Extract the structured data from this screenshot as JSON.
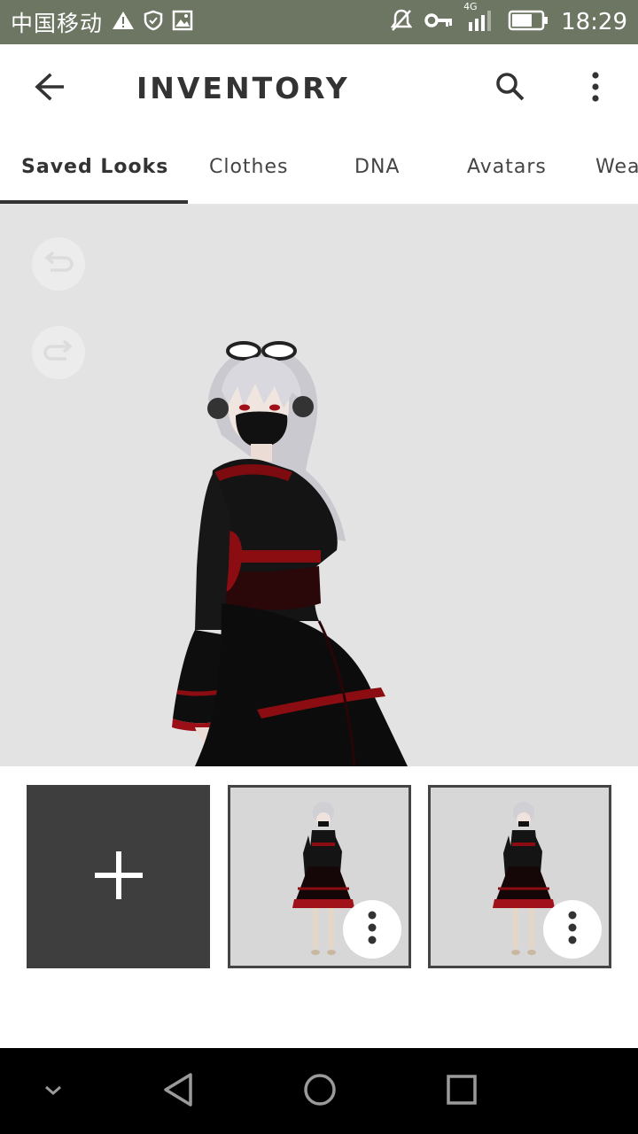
{
  "status_bar": {
    "carrier": "中国移动",
    "network": "4G",
    "time": "18:29",
    "icons": [
      "warning-icon",
      "shield-icon",
      "image-icon",
      "mute-icon",
      "key-icon",
      "signal-icon",
      "battery-icon"
    ]
  },
  "app_bar": {
    "title": "INVENTORY",
    "icons": [
      "back-arrow-icon",
      "search-icon",
      "more-vertical-icon"
    ]
  },
  "tabs": [
    {
      "label": "Saved Looks",
      "active": true
    },
    {
      "label": "Clothes",
      "active": false
    },
    {
      "label": "DNA",
      "active": false
    },
    {
      "label": "Avatars",
      "active": false
    },
    {
      "label": "Wea",
      "active": false
    }
  ],
  "preview": {
    "background": "#e3e3e3",
    "controls": [
      "undo-icon",
      "redo-icon"
    ]
  },
  "looks": {
    "add_icon": "plus-icon",
    "items": [
      {
        "thumbnail": "saved-look-thumbnail",
        "menu_icon": "more-vertical-icon"
      },
      {
        "thumbnail": "saved-look-thumbnail",
        "menu_icon": "more-vertical-icon"
      }
    ]
  },
  "nav_bar": {
    "icons": [
      "chevron-down-icon",
      "back-triangle-icon",
      "home-circle-icon",
      "recents-square-icon"
    ]
  },
  "colors": {
    "status_bar": "#6d7563",
    "accent_dark": "#333333",
    "add_tile": "#3e3e3e",
    "dress_red": "#8b0d12"
  }
}
